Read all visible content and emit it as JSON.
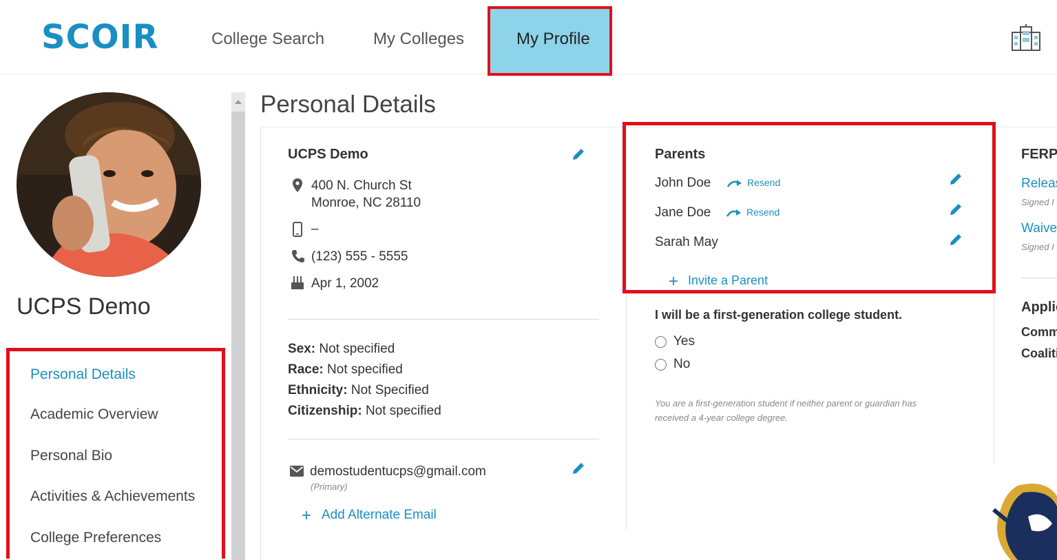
{
  "brand": {
    "logo_text": "SCOIR",
    "accent": "#1a8fc1",
    "highlight": "#e0101a",
    "active_nav_bg": "#8dd3ea"
  },
  "nav": {
    "college_search": "College Search",
    "my_colleges": "My Colleges",
    "my_profile": "My Profile",
    "right_icon": "school-building-icon"
  },
  "sidebar": {
    "student_name": "UCPS Demo",
    "items": [
      {
        "label": "Personal Details",
        "active": true
      },
      {
        "label": "Academic Overview",
        "active": false
      },
      {
        "label": "Personal Bio",
        "active": false
      },
      {
        "label": "Activities & Achievements",
        "active": false
      },
      {
        "label": "College Preferences",
        "active": false
      }
    ]
  },
  "main": {
    "page_title": "Personal Details",
    "contact": {
      "name": "UCPS Demo",
      "address_line1": "400 N. Church St",
      "address_line2": "Monroe, NC 28110",
      "mobile": "–",
      "phone": "(123) 555 - 5555",
      "birthday": "Apr 1, 2002"
    },
    "demographics": [
      {
        "label": "Sex:",
        "value": "Not specified"
      },
      {
        "label": "Race:",
        "value": "Not specified"
      },
      {
        "label": "Ethnicity:",
        "value": "Not Specified"
      },
      {
        "label": "Citizenship:",
        "value": "Not specified"
      }
    ],
    "email": {
      "address": "demostudentucps@gmail.com",
      "note": "(Primary)",
      "add_label": "Add Alternate Email"
    },
    "parents": {
      "title": "Parents",
      "list": [
        {
          "name": "John Doe",
          "resend": "Resend"
        },
        {
          "name": "Jane Doe",
          "resend": "Resend"
        },
        {
          "name": "Sarah May",
          "resend": ""
        }
      ],
      "invite_label": "Invite a Parent"
    },
    "first_gen": {
      "question": "I will be a first-generation college student.",
      "options": [
        "Yes",
        "No"
      ],
      "note_line1": "You are a first-generation student if neither parent or guardian has",
      "note_line2": "received a 4-year college degree."
    },
    "clipped_right": {
      "ferpa": "FERP",
      "release": "Releas",
      "release_signed": "Signed I",
      "waiver": "Waive",
      "waiver_signed": "Signed I",
      "applic": "Applic",
      "common": "Comm",
      "coalition": "Coaliti"
    }
  }
}
